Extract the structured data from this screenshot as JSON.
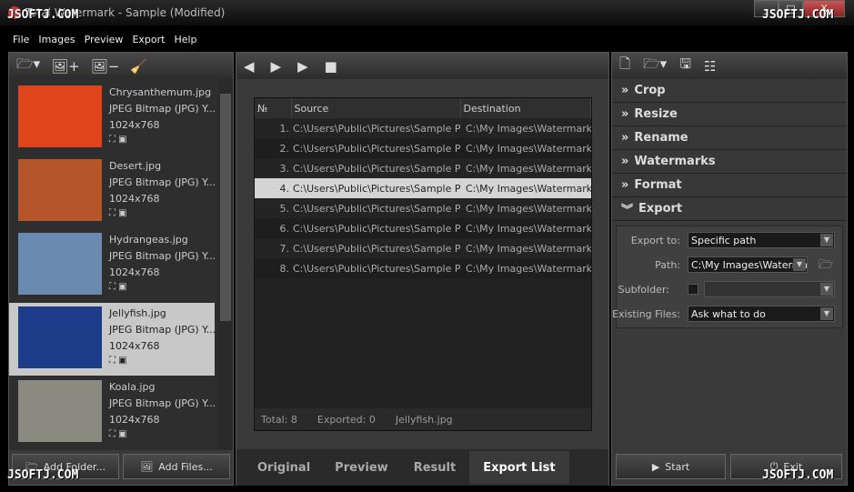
{
  "window": {
    "title": "Total Watermark - Sample (Modified)",
    "minimize": "_",
    "maximize": "□",
    "close": "X"
  },
  "menu": [
    "File",
    "Images",
    "Preview",
    "Export",
    "Help"
  ],
  "images": [
    {
      "name": "Chrysanthemum.jpg",
      "type": "JPEG Bitmap (JPG) Y...",
      "size": "1024x768",
      "color": "#e0441a"
    },
    {
      "name": "Desert.jpg",
      "type": "JPEG Bitmap (JPG) Y...",
      "size": "1024x768",
      "color": "#b5552a"
    },
    {
      "name": "Hydrangeas.jpg",
      "type": "JPEG Bitmap (JPG) Y...",
      "size": "1024x768",
      "color": "#6a8ab0"
    },
    {
      "name": "Jellyfish.jpg",
      "type": "JPEG Bitmap (JPG) Y...",
      "size": "1024x768",
      "color": "#1c3c8a"
    },
    {
      "name": "Koala.jpg",
      "type": "JPEG Bitmap (JPG) Y...",
      "size": "1024x768",
      "color": "#8a8a80"
    }
  ],
  "left_buttons": {
    "add_folder": "Add Folder...",
    "add_files": "Add Files..."
  },
  "table": {
    "headers": [
      "№",
      "Source",
      "Destination"
    ],
    "rows": [
      {
        "n": "1.",
        "src": "C:\\Users\\Public\\Pictures\\Sample Pict",
        "dst": "C:\\My Images\\Watermarke"
      },
      {
        "n": "2.",
        "src": "C:\\Users\\Public\\Pictures\\Sample Pict",
        "dst": "C:\\My Images\\Watermarke"
      },
      {
        "n": "3.",
        "src": "C:\\Users\\Public\\Pictures\\Sample Pict",
        "dst": "C:\\My Images\\Watermarke"
      },
      {
        "n": "4.",
        "src": "C:\\Users\\Public\\Pictures\\Sample Pict",
        "dst": "C:\\My Images\\Watermarke"
      },
      {
        "n": "5.",
        "src": "C:\\Users\\Public\\Pictures\\Sample Pict",
        "dst": "C:\\My Images\\Watermarke"
      },
      {
        "n": "6.",
        "src": "C:\\Users\\Public\\Pictures\\Sample Pict",
        "dst": "C:\\My Images\\Watermarke"
      },
      {
        "n": "7.",
        "src": "C:\\Users\\Public\\Pictures\\Sample Pict",
        "dst": "C:\\My Images\\Watermarke"
      },
      {
        "n": "8.",
        "src": "C:\\Users\\Public\\Pictures\\Sample Pict",
        "dst": "C:\\My Images\\Watermarke"
      }
    ]
  },
  "status": {
    "total": "Total: 8",
    "exported": "Exported: 0",
    "current": "Jellyfish.jpg"
  },
  "tabs": [
    "Original",
    "Preview",
    "Result",
    "Export List"
  ],
  "sections": [
    "Crop",
    "Resize",
    "Rename",
    "Watermarks",
    "Format",
    "Export"
  ],
  "export": {
    "export_to_label": "Export to:",
    "export_to": "Specific path",
    "path_label": "Path:",
    "path": "C:\\My Images\\Waterma",
    "subfolder_label": "Subfolder:",
    "existing_label": "Existing Files:",
    "existing": "Ask what to do"
  },
  "right_buttons": {
    "start": "Start",
    "exit": "Exit"
  },
  "watermark": "JSOFTJ.COM"
}
